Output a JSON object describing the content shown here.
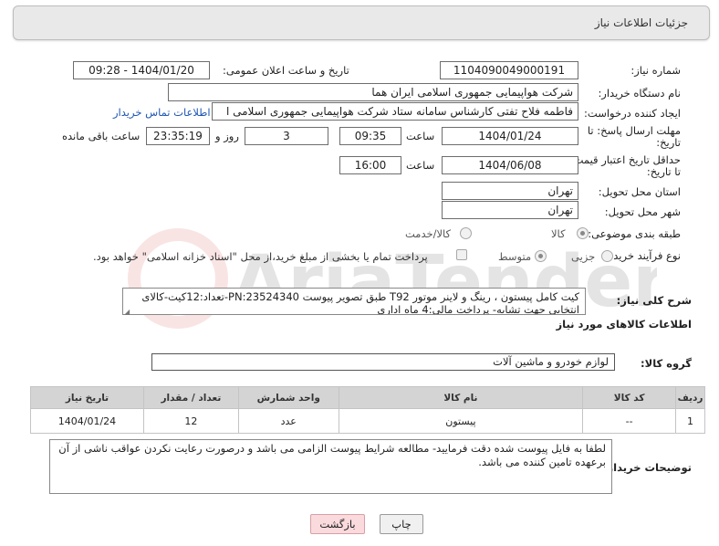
{
  "header": {
    "title": "جزئیات اطلاعات نیاز"
  },
  "need_number": {
    "label": "شماره نیاز:",
    "value": "1104090049000191"
  },
  "announce_datetime": {
    "label": "تاریخ و ساعت اعلان عمومی:",
    "value": "1404/01/20 - 09:28"
  },
  "buyer_org": {
    "label": "نام دستگاه خریدار:",
    "value": "شرکت هواپیمایی جمهوری اسلامی ایران هما"
  },
  "requester": {
    "label": "ایجاد کننده درخواست:",
    "value": "فاطمه فلاح تفتی کارشناس سامانه ستاد شرکت هواپیمایی جمهوری اسلامی ا",
    "contact_link": "اطلاعات تماس خریدار"
  },
  "reply_deadline": {
    "label_line1": "مهلت ارسال پاسخ: تا",
    "label_line2": "تاریخ:",
    "date": "1404/01/24",
    "time_label": "ساعت",
    "time": "09:35",
    "days": "3",
    "days_label": "روز و",
    "remaining": "23:35:19",
    "remaining_label": "ساعت باقی مانده"
  },
  "price_validity": {
    "label_line1": "حداقل تاریخ اعتبار قیمت:",
    "label_line2": "تا تاریخ:",
    "date": "1404/06/08",
    "time_label": "ساعت",
    "time": "16:00"
  },
  "delivery_province": {
    "label": "استان محل تحویل:",
    "value": "تهران"
  },
  "delivery_city": {
    "label": "شهر محل تحویل:",
    "value": "تهران"
  },
  "category": {
    "label": "طبقه بندی موضوعی:",
    "options": [
      "کالا",
      "کالا/خدمت"
    ],
    "selected": "کالا"
  },
  "purchase_type": {
    "label": "نوع فرآیند خرید :",
    "options": [
      "جزیی",
      "متوسط"
    ],
    "selected": "متوسط",
    "payment_note": "پرداخت تمام یا بخشی از مبلغ خرید،از محل \"اسناد خزانه اسلامی\" خواهد بود."
  },
  "description": {
    "label": "شرح کلی نیاز:",
    "value": "کیت کامل پیستون ، رینگ و لاینر موتور T92 طبق تصویر پیوست PN:23524340-تعداد:12کیت-کالای انتخابی جهت تشابه- پرداخت مالی:4 ماه اداری"
  },
  "goods_info": {
    "title": "اطلاعات کالاهای مورد نیاز"
  },
  "goods_group": {
    "label": "گروه کالا:",
    "value": "لوازم خودرو و ماشین آلات"
  },
  "goods_table": {
    "headers": [
      "ردیف",
      "کد کالا",
      "نام کالا",
      "واحد شمارش",
      "تعداد / مقدار",
      "تاریخ نیاز"
    ],
    "rows": [
      [
        "1",
        "--",
        "پیستون",
        "عدد",
        "12",
        "1404/01/24"
      ]
    ]
  },
  "buyer_notes": {
    "label": "توضیحات خریدار:",
    "value": "لطفا به فایل پیوست شده دقت فرمایید- مطالعه شرایط پیوست الزامی می باشد و درصورت رعایت نکردن عواقب ناشی از آن برعهده تامین کننده می باشد."
  },
  "buttons": {
    "print": "چاپ",
    "back": "بازگشت"
  },
  "colors": {
    "link": "#1e56b4",
    "header_bg": "#e9e9e9",
    "table_header_bg": "#d4d4d4",
    "back_button_bg": "#fadadd"
  },
  "watermark_text": "AriaTender.neT"
}
